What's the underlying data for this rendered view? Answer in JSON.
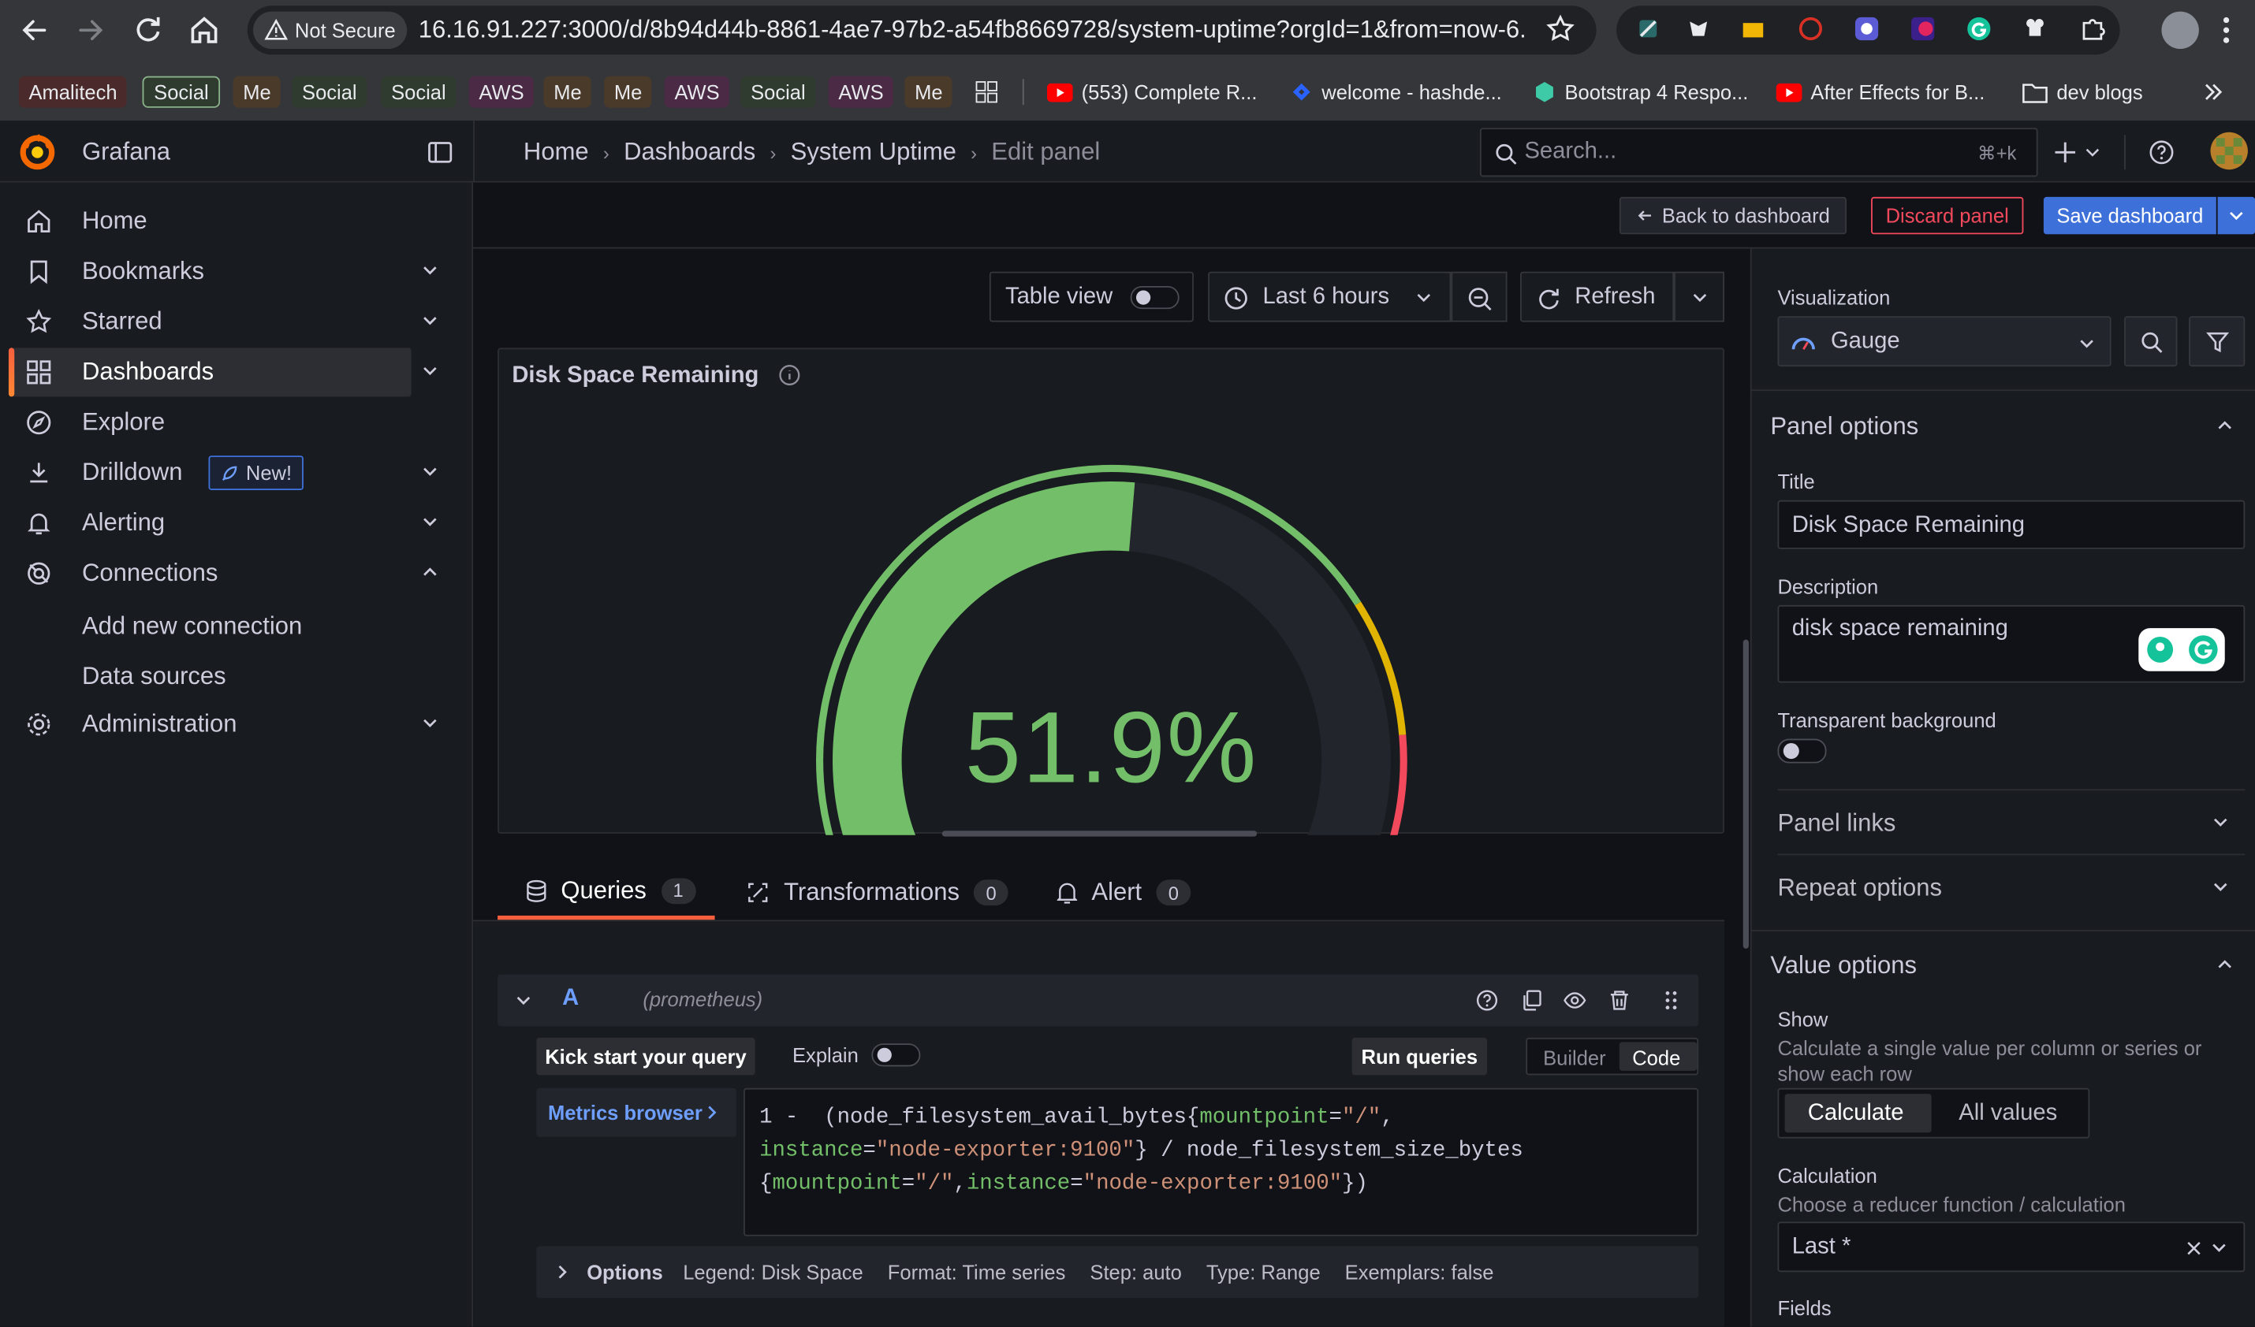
{
  "browser": {
    "security_label": "Not Secure",
    "url": "16.16.91.227:3000/d/8b94d44b-8861-4ae7-97b2-a54fb8669728/system-uptime?orgId=1&from=now-6...",
    "bookmarks": [
      {
        "label": "Amalitech",
        "color": "#4a2a2a",
        "text": "#e8eaed"
      },
      {
        "label": "Social",
        "color": "#2f3b2f",
        "text": "#e8eaed"
      },
      {
        "label": "Me",
        "color": "#4a3a2a",
        "text": "#e8eaed"
      },
      {
        "label": "Social",
        "color": "#2f3b2f",
        "text": "#e8eaed"
      },
      {
        "label": "Social",
        "color": "#2f3b2f",
        "text": "#e8eaed"
      },
      {
        "label": "AWS",
        "color": "#4a2a44",
        "text": "#e8eaed"
      },
      {
        "label": "Me",
        "color": "#4a3a2a",
        "text": "#e8eaed"
      },
      {
        "label": "Me",
        "color": "#4a3a2a",
        "text": "#e8eaed"
      },
      {
        "label": "AWS",
        "color": "#4a2a44",
        "text": "#e8eaed"
      },
      {
        "label": "Social",
        "color": "#2f3b2f",
        "text": "#e8eaed"
      },
      {
        "label": "AWS",
        "color": "#4a2a44",
        "text": "#e8eaed"
      },
      {
        "label": "Me",
        "color": "#4a3a2a",
        "text": "#e8eaed"
      }
    ],
    "bookmark_links": [
      "(553) Complete R...",
      "welcome - hashde...",
      "Bootstrap 4 Respo...",
      "After Effects for B...",
      "dev blogs"
    ]
  },
  "app": {
    "name": "Grafana",
    "breadcrumbs": [
      "Home",
      "Dashboards",
      "System Uptime",
      "Edit panel"
    ],
    "search_placeholder": "Search...",
    "search_shortcut": "⌘+k"
  },
  "sidebar": {
    "items": [
      {
        "label": "Home",
        "icon": "home-icon"
      },
      {
        "label": "Bookmarks",
        "icon": "bookmark-icon"
      },
      {
        "label": "Starred",
        "icon": "star-icon"
      },
      {
        "label": "Dashboards",
        "icon": "dashboards-icon"
      },
      {
        "label": "Explore",
        "icon": "compass-icon"
      },
      {
        "label": "Drilldown",
        "icon": "drilldown-icon",
        "badge": "New!"
      },
      {
        "label": "Alerting",
        "icon": "bell-icon"
      },
      {
        "label": "Connections",
        "icon": "connections-icon"
      },
      {
        "label": "Administration",
        "icon": "gear-icon"
      }
    ],
    "sub_items": [
      "Add new connection",
      "Data sources"
    ]
  },
  "toolbar": {
    "back": "Back to dashboard",
    "discard": "Discard panel",
    "save": "Save dashboard",
    "table_view": "Table view",
    "time_range": "Last 6 hours",
    "refresh": "Refresh"
  },
  "panel": {
    "title": "Disk Space Remaining",
    "value_text": "51.9%",
    "value_fraction": 0.519,
    "colors": {
      "green": "#73bf69",
      "yellow": "#fade2a",
      "orange": "#e0b400",
      "red": "#f2495c",
      "track": "#22252b"
    }
  },
  "query_tabs": [
    {
      "label": "Queries",
      "count": "1"
    },
    {
      "label": "Transformations",
      "count": "0"
    },
    {
      "label": "Alert",
      "count": "0"
    }
  ],
  "query": {
    "ref": "A",
    "datasource": "(prometheus)",
    "kick_start": "Kick start your query",
    "explain": "Explain",
    "run": "Run queries",
    "builder": "Builder",
    "code": "Code",
    "metrics_browser": "Metrics browser",
    "line1_a": "1 -  (node_filesystem_avail_bytes{",
    "line1_key": "mountpoint",
    "line1_eq": "=",
    "line1_val": "\"/\"",
    "line1_end": ",",
    "line2_key": "instance",
    "line2_eq": "=",
    "line2_val": "\"node-exporter:9100\"",
    "line2_end": "} / node_filesystem_size_bytes",
    "line3_a": "{",
    "line3_key1": "mountpoint",
    "line3_eq1": "=",
    "line3_val1": "\"/\"",
    "line3_comma": ",",
    "line3_key2": "instance",
    "line3_eq2": "=",
    "line3_val2": "\"node-exporter:9100\"",
    "line3_end": "})",
    "options_label": "Options",
    "options": [
      "Legend: Disk Space",
      "Format: Time series",
      "Step: auto",
      "Type: Range",
      "Exemplars: false"
    ]
  },
  "options_pane": {
    "visualization_label": "Visualization",
    "visualization": "Gauge",
    "panel_options": "Panel options",
    "title_label": "Title",
    "title_value": "Disk Space Remaining",
    "description_label": "Description",
    "description_value": "disk space remaining",
    "transparent_label": "Transparent background",
    "panel_links": "Panel links",
    "repeat_options": "Repeat options",
    "value_options": "Value options",
    "show_label": "Show",
    "show_desc": "Calculate a single value per column or series or show each row",
    "calculate": "Calculate",
    "all_values": "All values",
    "calculation_label": "Calculation",
    "calculation_desc": "Choose a reducer function / calculation",
    "calculation_value": "Last *",
    "fields_label": "Fields"
  }
}
